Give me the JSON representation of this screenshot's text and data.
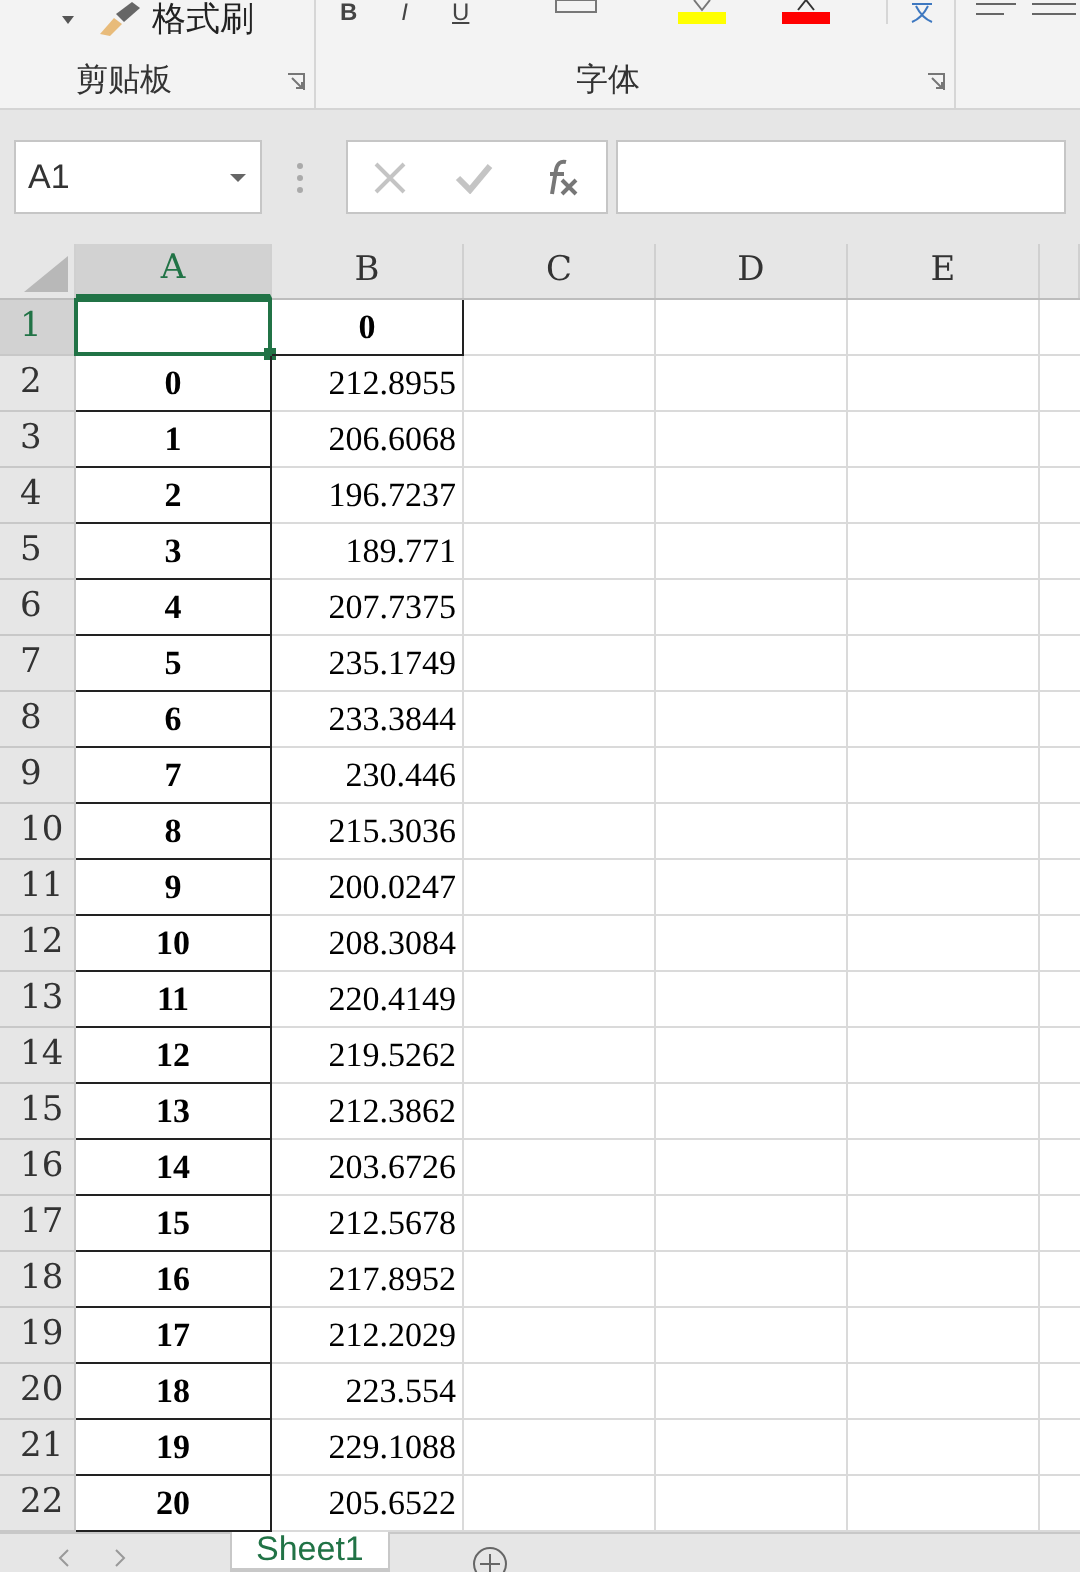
{
  "ribbon": {
    "format_painter": "格式刷",
    "font_buttons": [
      "B",
      "I",
      "U"
    ],
    "groups": [
      {
        "label": "剪贴板"
      },
      {
        "label": "字体"
      }
    ]
  },
  "formula_bar": {
    "name_box": "A1"
  },
  "sheet": {
    "columns": [
      {
        "label": "A",
        "selected": true
      },
      {
        "label": "B",
        "selected": false
      },
      {
        "label": "C",
        "selected": false
      },
      {
        "label": "D",
        "selected": false
      },
      {
        "label": "E",
        "selected": false
      }
    ],
    "rows": [
      {
        "number": "1",
        "selected": true,
        "cells": [
          "",
          "0"
        ]
      },
      {
        "number": "2",
        "selected": false,
        "cells": [
          "0",
          "212.8955"
        ]
      },
      {
        "number": "3",
        "selected": false,
        "cells": [
          "1",
          "206.6068"
        ]
      },
      {
        "number": "4",
        "selected": false,
        "cells": [
          "2",
          "196.7237"
        ]
      },
      {
        "number": "5",
        "selected": false,
        "cells": [
          "3",
          "189.771"
        ]
      },
      {
        "number": "6",
        "selected": false,
        "cells": [
          "4",
          "207.7375"
        ]
      },
      {
        "number": "7",
        "selected": false,
        "cells": [
          "5",
          "235.1749"
        ]
      },
      {
        "number": "8",
        "selected": false,
        "cells": [
          "6",
          "233.3844"
        ]
      },
      {
        "number": "9",
        "selected": false,
        "cells": [
          "7",
          "230.446"
        ]
      },
      {
        "number": "10",
        "selected": false,
        "cells": [
          "8",
          "215.3036"
        ]
      },
      {
        "number": "11",
        "selected": false,
        "cells": [
          "9",
          "200.0247"
        ]
      },
      {
        "number": "12",
        "selected": false,
        "cells": [
          "10",
          "208.3084"
        ]
      },
      {
        "number": "13",
        "selected": false,
        "cells": [
          "11",
          "220.4149"
        ]
      },
      {
        "number": "14",
        "selected": false,
        "cells": [
          "12",
          "219.5262"
        ]
      },
      {
        "number": "15",
        "selected": false,
        "cells": [
          "13",
          "212.3862"
        ]
      },
      {
        "number": "16",
        "selected": false,
        "cells": [
          "14",
          "203.6726"
        ]
      },
      {
        "number": "17",
        "selected": false,
        "cells": [
          "15",
          "212.5678"
        ]
      },
      {
        "number": "18",
        "selected": false,
        "cells": [
          "16",
          "217.8952"
        ]
      },
      {
        "number": "19",
        "selected": false,
        "cells": [
          "17",
          "212.2029"
        ]
      },
      {
        "number": "20",
        "selected": false,
        "cells": [
          "18",
          "223.554"
        ]
      },
      {
        "number": "21",
        "selected": false,
        "cells": [
          "19",
          "229.1088"
        ]
      },
      {
        "number": "22",
        "selected": false,
        "cells": [
          "20",
          "205.6522"
        ]
      }
    ]
  },
  "sheet_tabs": [
    {
      "label": "Sheet1",
      "selected": true
    }
  ]
}
